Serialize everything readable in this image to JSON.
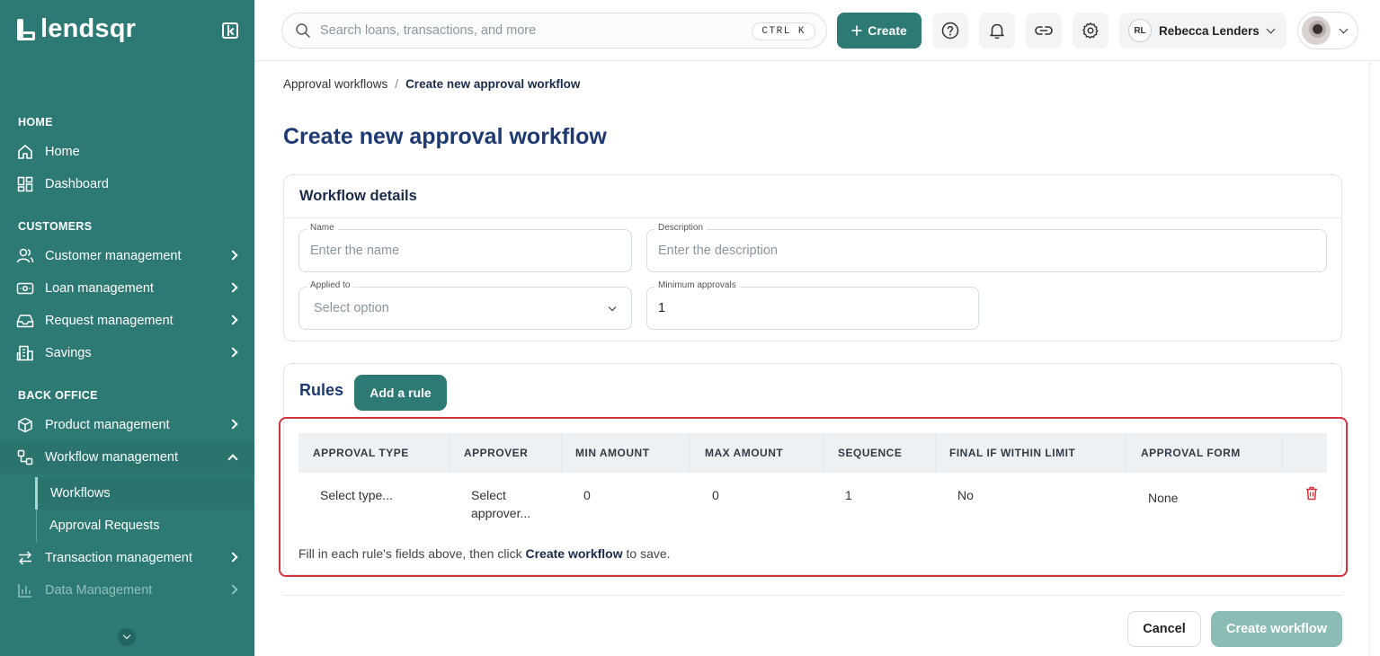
{
  "brand": {
    "name": "lendsqr"
  },
  "colors": {
    "primary": "#2c7a73",
    "highlight": "#d6333f",
    "title": "#1f3a73"
  },
  "sidebar": {
    "sections": [
      {
        "title": "HOME"
      },
      {
        "title": "CUSTOMERS"
      },
      {
        "title": "BACK OFFICE"
      }
    ],
    "items": [
      {
        "label": "Home",
        "icon": "home-icon"
      },
      {
        "label": "Dashboard",
        "icon": "dashboard-icon"
      },
      {
        "label": "Customer management",
        "icon": "users-icon"
      },
      {
        "label": "Loan management",
        "icon": "loan-icon"
      },
      {
        "label": "Request management",
        "icon": "inbox-icon"
      },
      {
        "label": "Savings",
        "icon": "bank-icon"
      },
      {
        "label": "Product management",
        "icon": "box-icon"
      },
      {
        "label": "Workflow management",
        "icon": "workflow-icon"
      },
      {
        "label": "Transaction management",
        "icon": "transfer-icon"
      },
      {
        "label": "Data Management",
        "icon": "chart-icon"
      }
    ],
    "sub_items": [
      {
        "label": "Workflows"
      },
      {
        "label": "Approval Requests"
      }
    ]
  },
  "topbar": {
    "search_placeholder": "Search loans, transactions, and more",
    "shortcut": "CTRL K",
    "create_label": "Create",
    "user_initials": "RL",
    "user_name": "Rebecca Lenders"
  },
  "breadcrumb": {
    "parent": "Approval workflows",
    "separator": "/",
    "current": "Create new approval workflow"
  },
  "page_title": "Create new approval workflow",
  "workflow_details": {
    "title": "Workflow details",
    "name": {
      "label": "Name",
      "placeholder": "Enter the name"
    },
    "description": {
      "label": "Description",
      "placeholder": "Enter the description"
    },
    "applied_to": {
      "label": "Applied to",
      "value": "Select option"
    },
    "min_approvals": {
      "label": "Minimum approvals",
      "value": "1"
    }
  },
  "rules": {
    "title": "Rules",
    "add_label": "Add a rule",
    "columns": [
      "APPROVAL TYPE",
      "APPROVER",
      "MIN AMOUNT",
      "MAX AMOUNT",
      "SEQUENCE",
      "FINAL IF WITHIN LIMIT",
      "APPROVAL FORM"
    ],
    "row": {
      "approval_type": "Select type...",
      "approver_1": "Select",
      "approver_2": "approver...",
      "min_amount": "0",
      "max_amount": "0",
      "sequence": "1",
      "final_if_within_limit": "No",
      "approval_form": "None"
    },
    "hint_before": "Fill in each rule's fields above, then click ",
    "hint_bold": "Create workflow",
    "hint_after": " to save."
  },
  "footer": {
    "cancel_label": "Cancel",
    "submit_label": "Create workflow"
  }
}
